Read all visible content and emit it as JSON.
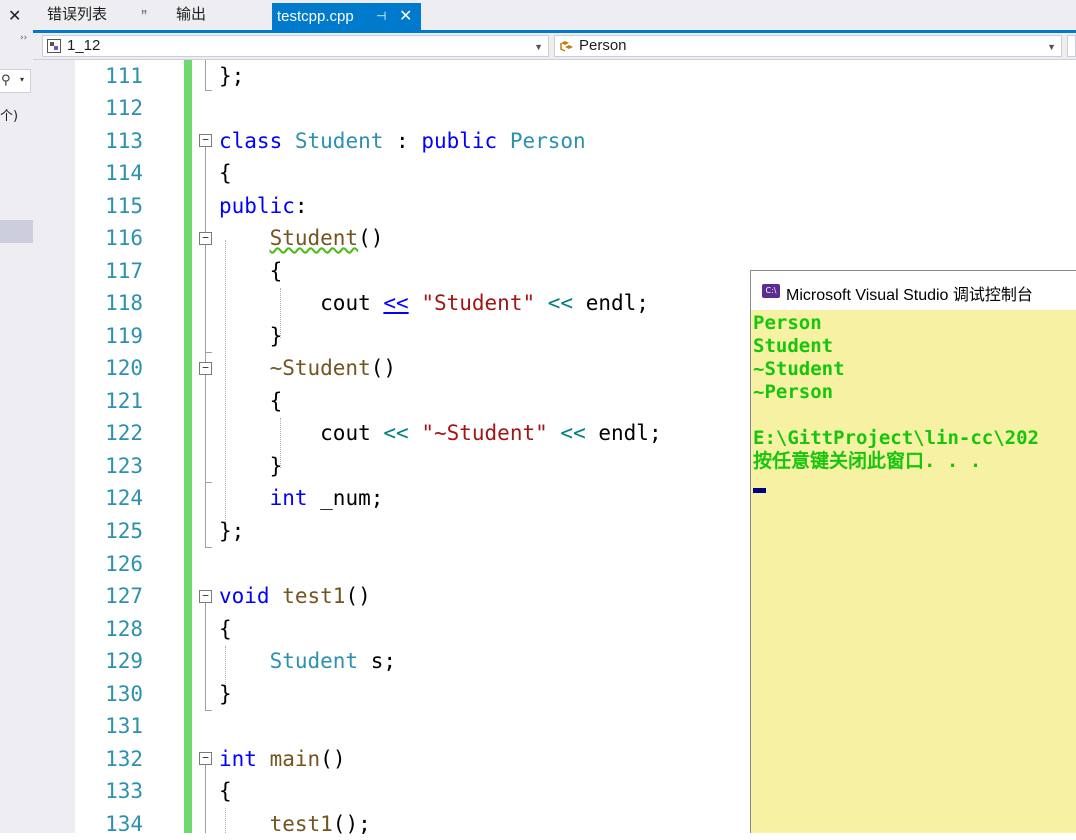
{
  "left_panel": {
    "close_glyph": "✕",
    "fragment_text": "个)"
  },
  "tabs": [
    {
      "label": "错误列表",
      "pin": "ꟸ"
    },
    {
      "label": "输出"
    },
    {
      "label": "testcpp.cpp",
      "pin": "⊣",
      "close": "✕",
      "active": true
    }
  ],
  "navbar": {
    "project_scope": "1_12",
    "member_scope": "Person"
  },
  "editor": {
    "lines": [
      {
        "n": "111"
      },
      {
        "n": "112"
      },
      {
        "n": "113"
      },
      {
        "n": "114"
      },
      {
        "n": "115"
      },
      {
        "n": "116"
      },
      {
        "n": "117"
      },
      {
        "n": "118"
      },
      {
        "n": "119"
      },
      {
        "n": "120"
      },
      {
        "n": "121"
      },
      {
        "n": "122"
      },
      {
        "n": "123"
      },
      {
        "n": "124"
      },
      {
        "n": "125"
      },
      {
        "n": "126"
      },
      {
        "n": "127"
      },
      {
        "n": "128"
      },
      {
        "n": "129"
      },
      {
        "n": "130"
      },
      {
        "n": "131"
      },
      {
        "n": "132"
      },
      {
        "n": "133"
      },
      {
        "n": "134"
      }
    ],
    "code": {
      "l111": "};",
      "l113_kw1": "class",
      "l113_t1": "Student",
      "l113_sep": " : ",
      "l113_kw2": "public",
      "l113_t2": "Person",
      "l114": "{",
      "l115_kw": "public",
      "l115_colon": ":",
      "l116_fn": "Student",
      "l116_p": "()",
      "l117": "{",
      "l118_a": "cout ",
      "l118_op": "<<",
      "l118_s": "\"Student\"",
      "l118_op2": "<<",
      "l118_b": "endl;",
      "l119": "}",
      "l120_fn": "~Student",
      "l120_p": "()",
      "l121": "{",
      "l122_a": "cout ",
      "l122_op": "<<",
      "l122_s": "\"~Student\"",
      "l122_op2": "<<",
      "l122_b": "endl;",
      "l123": "}",
      "l124_kw": "int",
      "l124_rest": " _num;",
      "l125": "};",
      "l127_kw": "void",
      "l127_fn": "test1",
      "l127_p": "()",
      "l128": "{",
      "l129_t": "Student",
      "l129_rest": " s;",
      "l130": "}",
      "l132_kw": "int",
      "l132_fn": "main",
      "l132_p": "()",
      "l133": "{",
      "l134_fn": "test1",
      "l134_p": "();"
    }
  },
  "console": {
    "icon_label": "C:\\",
    "title": "Microsoft Visual Studio 调试控制台",
    "output": "Person\nStudent\n~Student\n~Person\n\nE:\\GittProject\\lin-cc\\202\n按任意键关闭此窗口. . ."
  },
  "colors": {
    "accent": "#007acc",
    "change_bar": "#6ed96e",
    "console_bg": "#f7f1a4",
    "console_text": "#16c60c"
  }
}
